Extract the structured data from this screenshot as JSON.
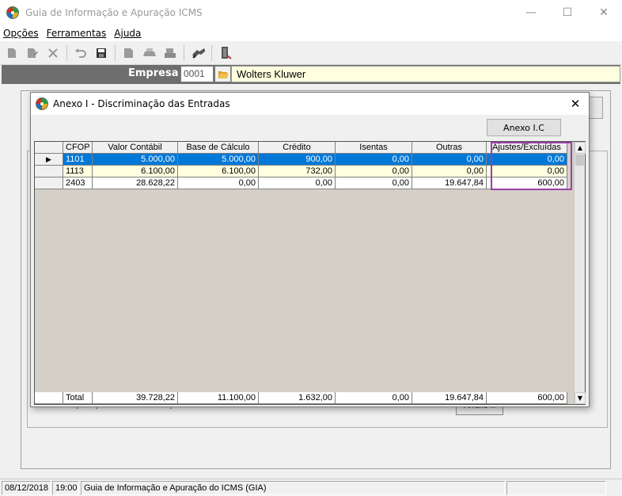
{
  "main_window": {
    "title": "Guia de Informação e Apuração ICMS",
    "controls": {
      "minimize": "—",
      "maximize": "☐",
      "close": "✕"
    }
  },
  "menu": [
    {
      "label": "Opções",
      "underline": "O"
    },
    {
      "label": "Ferramentas",
      "underline": "F"
    },
    {
      "label": "Ajuda",
      "underline": "A"
    }
  ],
  "toolbar_icons": [
    "new-doc-icon",
    "edit-doc-icon",
    "delete-icon",
    "undo-icon",
    "save-icon",
    "report-icon",
    "print-icon",
    "print-setup-icon",
    "tools-icon",
    "exit-icon"
  ],
  "empresa": {
    "label": "Empresa",
    "code": "0001",
    "name": "Wolters Kluwer"
  },
  "background": {
    "text_fragment": "Total de operações com substituição tributária...",
    "anexo_button": "Anexo II"
  },
  "dialog": {
    "title": "Anexo I - Discriminação das Entradas",
    "close": "✕",
    "anexo_button": "Anexo I.C",
    "grid": {
      "columns": [
        "CFOP",
        "Valor Contábil",
        "Base de Cálculo",
        "Crédito",
        "Isentas",
        "Outras",
        "Ajustes/Excluídas"
      ],
      "rows": [
        {
          "cfop": "1101",
          "valor": "5.000,00",
          "base": "5.000,00",
          "credito": "900,00",
          "isentas": "0,00",
          "outras": "0,00",
          "ajustes": "0,00"
        },
        {
          "cfop": "1113",
          "valor": "6.100,00",
          "base": "6.100,00",
          "credito": "732,00",
          "isentas": "0,00",
          "outras": "0,00",
          "ajustes": "0,00"
        },
        {
          "cfop": "2403",
          "valor": "28.628,22",
          "base": "0,00",
          "credito": "0,00",
          "isentas": "0,00",
          "outras": "19.647,84",
          "ajustes": "600,00"
        }
      ],
      "total": {
        "label": "Total",
        "valor": "39.728,22",
        "base": "11.100,00",
        "credito": "1.632,00",
        "isentas": "0,00",
        "outras": "19.647,84",
        "ajustes": "600,00"
      },
      "highlight_color": "#9b3fa8",
      "selected_row_color": "#0078d7"
    }
  },
  "statusbar": {
    "date": "08/12/2018",
    "time": "19:00",
    "message": "Guia de Informação e Apuração do ICMS (GIA)"
  }
}
